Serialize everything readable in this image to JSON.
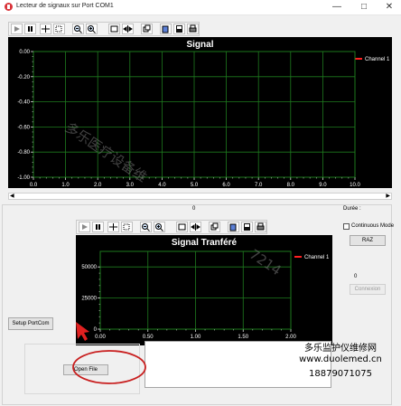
{
  "window": {
    "title": "Lecteur de signaux sur Port COM1",
    "minimize": "—",
    "maximize": "□",
    "close": "✕"
  },
  "toolbar_icons": [
    "play-icon",
    "pause-icon",
    "pan-icon",
    "zoom-select-icon",
    "zoom-out-icon",
    "zoom-in-icon",
    "frame-icon",
    "cursor-icon",
    "copy-icon",
    "paste-icon",
    "save-icon",
    "print-icon"
  ],
  "chart1": {
    "chart_data": {
      "type": "line",
      "title": "Signal",
      "series": [
        {
          "name": "Channel 1",
          "values": []
        }
      ],
      "xlim": [
        0,
        10
      ],
      "ylim": [
        -1,
        0
      ],
      "xticks": [
        "0.0",
        "1.0",
        "2.0",
        "3.0",
        "4.0",
        "5.0",
        "6.0",
        "7.0",
        "8.0",
        "9.0",
        "10.0"
      ],
      "yticks": [
        "0.00",
        "-0.20",
        "-0.40",
        "-0.60",
        "-0.80",
        "-1.00"
      ],
      "grid": true,
      "legend": "top-right",
      "colors": {
        "background": "#000000",
        "grid": "#1e7a1e",
        "series": "#ff2020"
      }
    }
  },
  "scrollbar_value": "0",
  "duree_label": "Durée :",
  "chart2": {
    "chart_data": {
      "type": "line",
      "title": "Signal Tranféré",
      "series": [
        {
          "name": "Channel 1",
          "values": []
        }
      ],
      "xlim": [
        0,
        2
      ],
      "ylim": [
        0,
        62500
      ],
      "xticks": [
        "0.00",
        "0.50",
        "1.00",
        "1.50",
        "2.00"
      ],
      "yticks": [
        "50000",
        "25000",
        "0"
      ],
      "grid": true,
      "legend": "top-right",
      "colors": {
        "background": "#000000",
        "grid": "#1e7a1e",
        "series": "#ff2020"
      }
    }
  },
  "continuous_mode": {
    "label": "Continuous Mode",
    "checked": false
  },
  "raz_button": "RAZ",
  "count_value": "0",
  "connexion_button": "Connexion",
  "setup_button": "Setup PortCom",
  "open_file_button": "Open File",
  "watermark": {
    "line1": "多乐医疗设备维",
    "line2": "7214",
    "site_name": "多乐监护仪维修网",
    "url": "www.duolemed.cn",
    "phone": "18879071075"
  }
}
